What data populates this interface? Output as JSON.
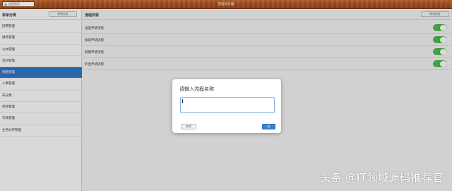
{
  "window": {
    "title": "流程设计器",
    "back_button": "返回首页"
  },
  "sidebar": {
    "title": "表单分类",
    "add_button": "新增分类",
    "items": [
      {
        "label": "招聘管理",
        "active": false
      },
      {
        "label": "财务管理",
        "active": false
      },
      {
        "label": "公文管理",
        "active": false
      },
      {
        "label": "合同管理",
        "active": false
      },
      {
        "label": "假勤管理",
        "active": true
      },
      {
        "label": "人事管理",
        "active": false
      },
      {
        "label": "未分类",
        "active": false
      },
      {
        "label": "项目管理",
        "active": false
      },
      {
        "label": "行政管理",
        "active": false
      },
      {
        "label": "业务伙伴管理",
        "active": false
      }
    ]
  },
  "main": {
    "title": "流程列表",
    "add_button": "新增流程",
    "flows": [
      {
        "name": "出差申请流程",
        "enabled": true
      },
      {
        "name": "加班申请流程",
        "enabled": true
      },
      {
        "name": "假期申请流程",
        "enabled": true
      },
      {
        "name": "外出申请流程",
        "enabled": true
      }
    ]
  },
  "dialog": {
    "title": "请输入流程名称",
    "input_value": "",
    "cancel_label": "取消",
    "ok_label": "好"
  },
  "watermark": "头条 @IT领域源码推荐官",
  "colors": {
    "accent": "#2f74c4",
    "toggle_on": "#4cb84c",
    "titlebar": "#9a4a1f"
  }
}
